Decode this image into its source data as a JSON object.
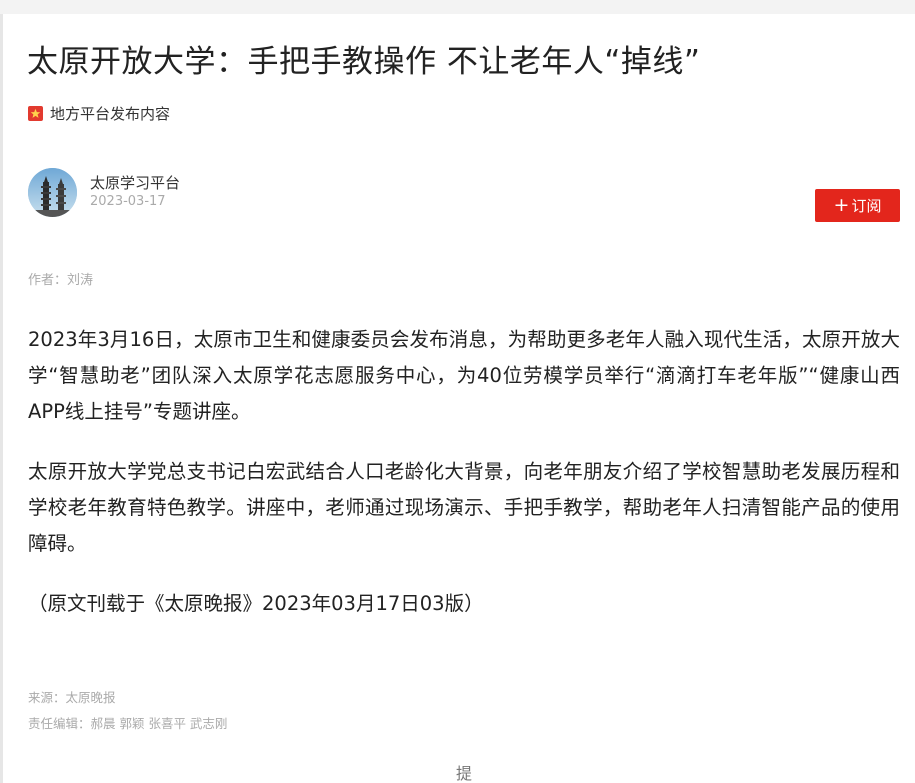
{
  "article": {
    "title": "太原开放大学：手把手教操作 不让老年人“掉线”",
    "origin_label": "地方平台发布内容",
    "publisher": {
      "name": "太原学习平台",
      "date": "2023-03-17"
    },
    "subscribe_label": "订阅",
    "subscribe_plus": "+",
    "author": "作者：刘涛",
    "paragraphs": [
      "2023年3月16日，太原市卫生和健康委员会发布消息，为帮助更多老年人融入现代生活，太原开放大学“智慧助老”团队深入太原学花志愿服务中心，为40位劳模学员举行“滴滴打车老年版”“健康山西APP线上挂号”专题讲座。",
      "太原开放大学党总支书记白宏武结合人口老龄化大背景，向老年朋友介绍了学校智慧助老发展历程和学校老年教育特色教学。讲座中，老师通过现场演示、手把手教学，帮助老年人扫清智能产品的使用障碍。",
      "（原文刊载于《太原晚报》2023年03月17日03版）"
    ],
    "source": "来源：太原晚报",
    "editors": "责任编辑：郝晨 郭颖 张喜平 武志刚",
    "tip_label": "提\n醒"
  },
  "colors": {
    "accent": "#e3261c",
    "origin_icon": "#e23a2f",
    "muted_text": "#aaaaaa",
    "body_text": "#222222"
  },
  "icons": {
    "origin": "star-badge-icon",
    "avatar": "pagoda-avatar"
  }
}
